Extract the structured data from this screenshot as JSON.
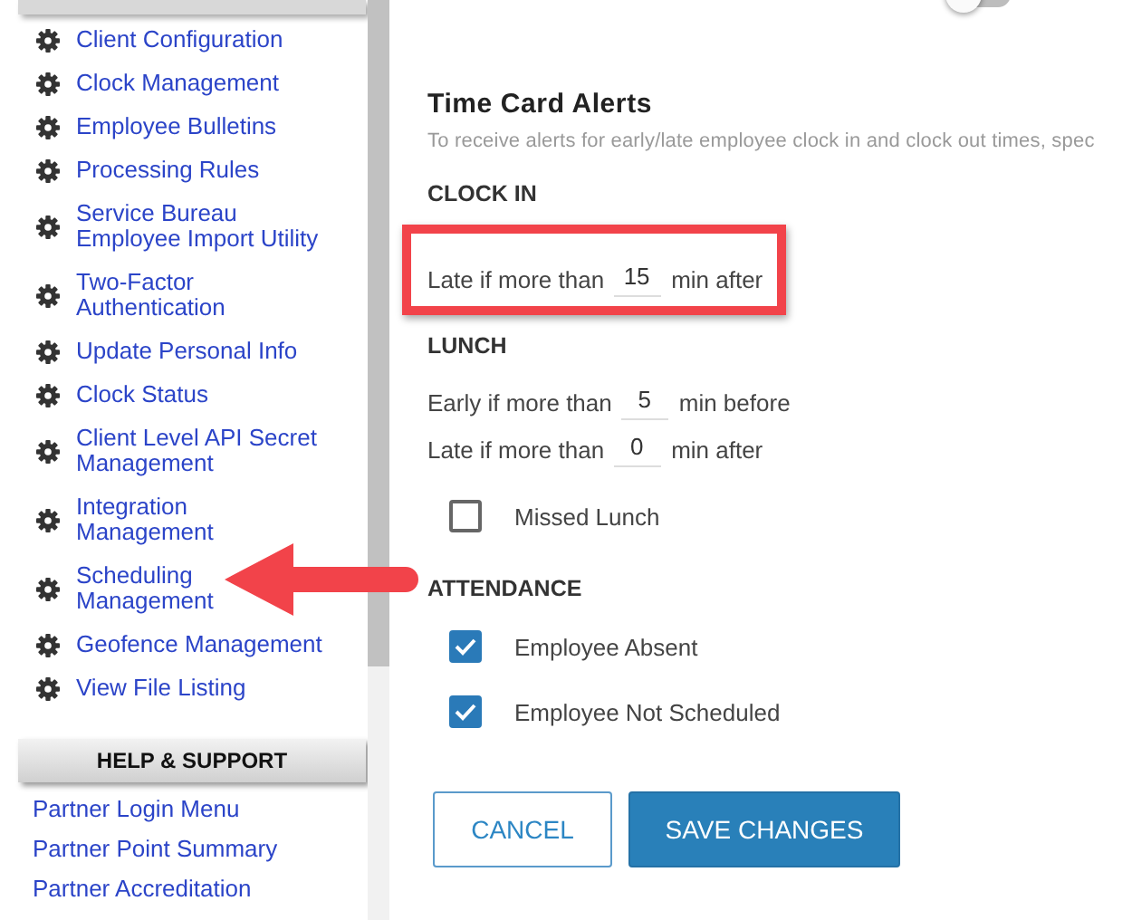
{
  "sidebar": {
    "items": [
      {
        "label": "Client Configuration",
        "pointed": false
      },
      {
        "label": "Clock Management",
        "pointed": false
      },
      {
        "label": "Employee Bulletins",
        "pointed": false
      },
      {
        "label": "Processing Rules",
        "pointed": false
      },
      {
        "label": "Service Bureau Employee Import Utility",
        "pointed": false
      },
      {
        "label": "Two-Factor Authentication",
        "pointed": false
      },
      {
        "label": "Update Personal Info",
        "pointed": false
      },
      {
        "label": "Clock Status",
        "pointed": false
      },
      {
        "label": "Client Level API Secret Management",
        "pointed": false
      },
      {
        "label": "Integration Management",
        "pointed": false
      },
      {
        "label": "Scheduling Management",
        "pointed": true
      },
      {
        "label": "Geofence Management",
        "pointed": false
      },
      {
        "label": "View File Listing",
        "pointed": false
      }
    ],
    "help_title": "HELP & SUPPORT",
    "help_links": [
      "Partner Login Menu",
      "Partner Point Summary",
      "Partner Accreditation"
    ]
  },
  "alerts": {
    "toggle": {
      "on": false
    },
    "title": "Time Card Alerts",
    "subtitle": "To receive alerts for early/late employee clock in and clock out times, spec",
    "sections": [
      {
        "heading": "CLOCK IN",
        "rows": [
          {
            "kind": "threshold",
            "prefix": "Late if more than",
            "value": "15",
            "suffix": "min after",
            "highlighted": true
          }
        ]
      },
      {
        "heading": "LUNCH",
        "rows": [
          {
            "kind": "threshold",
            "prefix": "Early if more than",
            "value": "5",
            "suffix": "min before",
            "highlighted": false
          },
          {
            "kind": "threshold",
            "prefix": "Late if more than",
            "value": "0",
            "suffix": "min after",
            "highlighted": false
          },
          {
            "kind": "checkbox",
            "label": "Missed Lunch",
            "checked": false
          }
        ]
      },
      {
        "heading": "ATTENDANCE",
        "rows": [
          {
            "kind": "checkbox",
            "label": "Employee Absent",
            "checked": true
          },
          {
            "kind": "checkbox",
            "label": "Employee Not Scheduled",
            "checked": true
          }
        ]
      }
    ],
    "buttons": [
      {
        "label": "CANCEL",
        "kind": "secondary"
      },
      {
        "label": "SAVE CHANGES",
        "kind": "primary"
      }
    ]
  }
}
